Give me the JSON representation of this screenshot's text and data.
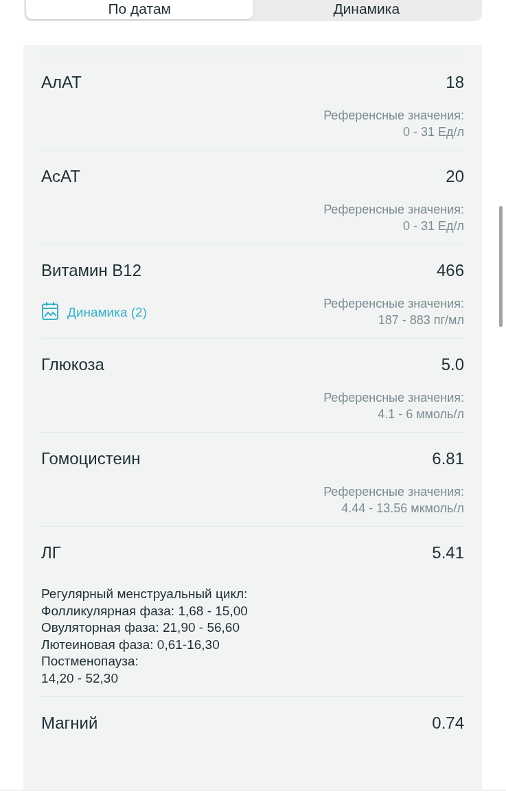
{
  "tabs": [
    {
      "label": "По датам",
      "selected": true
    },
    {
      "label": "Динамика",
      "selected": false
    }
  ],
  "results": [
    {
      "kind": "standard",
      "name": "АлАТ",
      "value": "18",
      "reference_label": "Референсные значения:",
      "reference_value": "0 - 31 Ед/л"
    },
    {
      "kind": "standard",
      "name": "АсАТ",
      "value": "20",
      "reference_label": "Референсные значения:",
      "reference_value": "0 - 31 Ед/л"
    },
    {
      "kind": "standard",
      "name": "Витамин B12",
      "value": "466",
      "dynamics_link": "Динамика (2)",
      "reference_label": "Референсные значения:",
      "reference_value": "187 - 883 пг/мл"
    },
    {
      "kind": "standard",
      "name": "Глюкоза",
      "value": "5.0",
      "reference_label": "Референсные значения:",
      "reference_value": "4.1 - 6 ммоль/л"
    },
    {
      "kind": "standard",
      "name": "Гомоцистеин",
      "value": "6.81",
      "reference_label": "Референсные значения:",
      "reference_value": "4.44 - 13.56 мкмоль/л"
    },
    {
      "kind": "phases",
      "name": "ЛГ",
      "value": "5.41",
      "reference_lines": [
        "Регулярный менструальный цикл:",
        "Фолликулярная фаза: 1,68 - 15,00",
        "Овуляторная фаза: 21,90 - 56,60",
        "Лютеиновая фаза: 0,61-16,30",
        "Постменопауза:",
        "14,20 - 52,30"
      ]
    },
    {
      "kind": "value_only",
      "name": "Магний",
      "value": "0.74"
    }
  ]
}
